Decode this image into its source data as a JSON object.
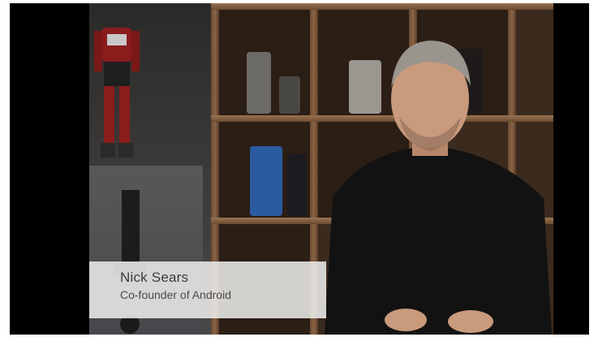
{
  "lower_third": {
    "name": "Nick Sears",
    "title": "Co-founder of Android"
  },
  "colors": {
    "letterbox": "#000000",
    "caption_bg": "#ebebe8",
    "caption_text": "#3a3a3a"
  }
}
